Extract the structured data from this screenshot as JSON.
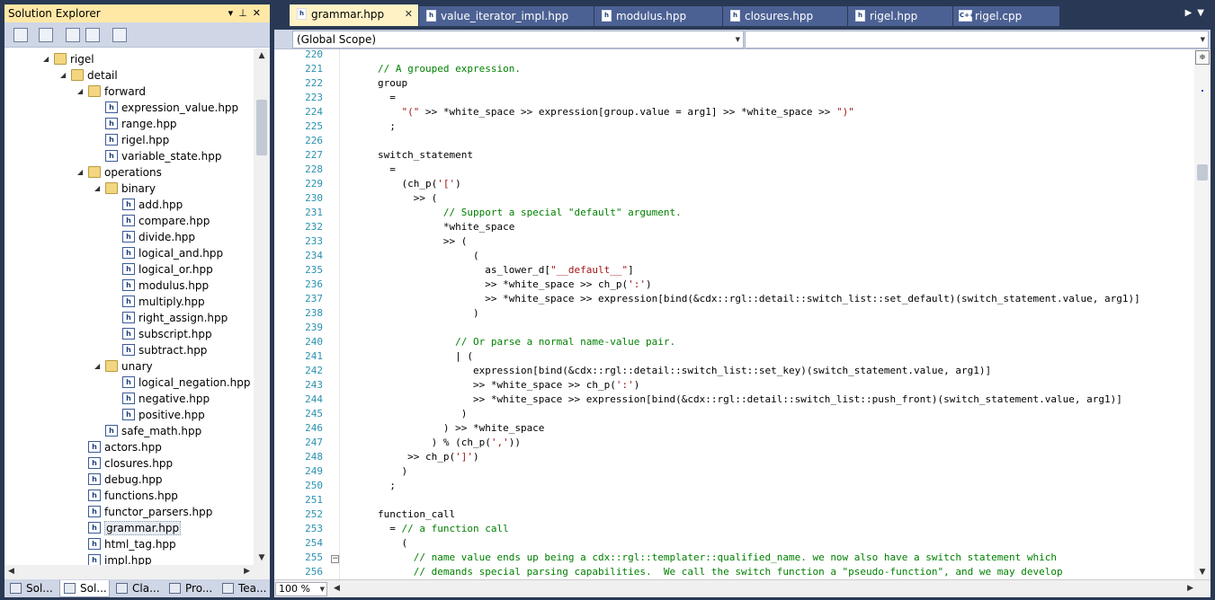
{
  "solution_explorer": {
    "title": "Solution Explorer",
    "title_buttons": [
      "▾",
      "⊥",
      "✕"
    ],
    "tree": [
      {
        "label": "rigel",
        "kind": "folder",
        "depth": 2,
        "expanded": true
      },
      {
        "label": "detail",
        "kind": "folder",
        "depth": 3,
        "expanded": true
      },
      {
        "label": "forward",
        "kind": "folder",
        "depth": 4,
        "expanded": true
      },
      {
        "label": "expression_value.hpp",
        "kind": "file",
        "depth": 5
      },
      {
        "label": "range.hpp",
        "kind": "file",
        "depth": 5
      },
      {
        "label": "rigel.hpp",
        "kind": "file",
        "depth": 5
      },
      {
        "label": "variable_state.hpp",
        "kind": "file",
        "depth": 5
      },
      {
        "label": "operations",
        "kind": "folder",
        "depth": 4,
        "expanded": true
      },
      {
        "label": "binary",
        "kind": "folder",
        "depth": 5,
        "expanded": true
      },
      {
        "label": "add.hpp",
        "kind": "file",
        "depth": 6
      },
      {
        "label": "compare.hpp",
        "kind": "file",
        "depth": 6
      },
      {
        "label": "divide.hpp",
        "kind": "file",
        "depth": 6
      },
      {
        "label": "logical_and.hpp",
        "kind": "file",
        "depth": 6
      },
      {
        "label": "logical_or.hpp",
        "kind": "file",
        "depth": 6
      },
      {
        "label": "modulus.hpp",
        "kind": "file",
        "depth": 6
      },
      {
        "label": "multiply.hpp",
        "kind": "file",
        "depth": 6
      },
      {
        "label": "right_assign.hpp",
        "kind": "file",
        "depth": 6
      },
      {
        "label": "subscript.hpp",
        "kind": "file",
        "depth": 6
      },
      {
        "label": "subtract.hpp",
        "kind": "file",
        "depth": 6
      },
      {
        "label": "unary",
        "kind": "folder",
        "depth": 5,
        "expanded": true
      },
      {
        "label": "logical_negation.hpp",
        "kind": "file",
        "depth": 6
      },
      {
        "label": "negative.hpp",
        "kind": "file",
        "depth": 6
      },
      {
        "label": "positive.hpp",
        "kind": "file",
        "depth": 6
      },
      {
        "label": "safe_math.hpp",
        "kind": "file",
        "depth": 5
      },
      {
        "label": "actors.hpp",
        "kind": "file",
        "depth": 4
      },
      {
        "label": "closures.hpp",
        "kind": "file",
        "depth": 4
      },
      {
        "label": "debug.hpp",
        "kind": "file",
        "depth": 4
      },
      {
        "label": "functions.hpp",
        "kind": "file",
        "depth": 4
      },
      {
        "label": "functor_parsers.hpp",
        "kind": "file",
        "depth": 4
      },
      {
        "label": "grammar.hpp",
        "kind": "file",
        "depth": 4,
        "selected": true
      },
      {
        "label": "html_tag.hpp",
        "kind": "file",
        "depth": 4
      },
      {
        "label": "impl.hpp",
        "kind": "file",
        "depth": 4
      }
    ],
    "bottom_tabs": [
      {
        "label": "Sol...",
        "active": false
      },
      {
        "label": "Sol...",
        "active": true
      },
      {
        "label": "Cla...",
        "active": false
      },
      {
        "label": "Pro...",
        "active": false
      },
      {
        "label": "Tea...",
        "active": false
      }
    ]
  },
  "editor": {
    "tabs": [
      {
        "label": "grammar.hpp",
        "active": true,
        "icon": "h"
      },
      {
        "label": "value_iterator_impl.hpp",
        "active": false,
        "icon": "h"
      },
      {
        "label": "modulus.hpp",
        "active": false,
        "icon": "h"
      },
      {
        "label": "closures.hpp",
        "active": false,
        "icon": "h"
      },
      {
        "label": "rigel.hpp",
        "active": false,
        "icon": "h"
      },
      {
        "label": "rigel.cpp",
        "active": false,
        "icon": "C++"
      }
    ],
    "scope": "(Global Scope)",
    "member": "",
    "zoom": "100 %",
    "lines": [
      {
        "n": "220",
        "t": ""
      },
      {
        "n": "221",
        "t": "// A grouped expression.",
        "c": true
      },
      {
        "n": "222",
        "t": "group"
      },
      {
        "n": "223",
        "t": "  ="
      },
      {
        "n": "224",
        "t": "    \"(\" >> *white_space >> expression[group.value = arg1] >> *white_space >> \")\""
      },
      {
        "n": "225",
        "t": "  ;"
      },
      {
        "n": "226",
        "t": ""
      },
      {
        "n": "227",
        "t": "switch_statement"
      },
      {
        "n": "228",
        "t": "  ="
      },
      {
        "n": "229",
        "t": "    (ch_p('[')"
      },
      {
        "n": "230",
        "t": "      >> ("
      },
      {
        "n": "231",
        "t": "           // Support a special \"default\" argument.",
        "c": true
      },
      {
        "n": "232",
        "t": "           *white_space"
      },
      {
        "n": "233",
        "t": "           >> ("
      },
      {
        "n": "234",
        "t": "                ("
      },
      {
        "n": "235",
        "t": "                  as_lower_d[\"__default__\"]"
      },
      {
        "n": "236",
        "t": "                  >> *white_space >> ch_p(':')"
      },
      {
        "n": "237",
        "t": "                  >> *white_space >> expression[bind(&cdx::rgl::detail::switch_list::set_default)(switch_statement.value, arg1)]"
      },
      {
        "n": "238",
        "t": "                )"
      },
      {
        "n": "239",
        "t": ""
      },
      {
        "n": "240",
        "t": "             // Or parse a normal name-value pair.",
        "c": true
      },
      {
        "n": "241",
        "t": "             | ("
      },
      {
        "n": "242",
        "t": "                expression[bind(&cdx::rgl::detail::switch_list::set_key)(switch_statement.value, arg1)]"
      },
      {
        "n": "243",
        "t": "                >> *white_space >> ch_p(':')"
      },
      {
        "n": "244",
        "t": "                >> *white_space >> expression[bind(&cdx::rgl::detail::switch_list::push_front)(switch_statement.value, arg1)]"
      },
      {
        "n": "245",
        "t": "              )"
      },
      {
        "n": "246",
        "t": "           ) >> *white_space"
      },
      {
        "n": "247",
        "t": "         ) % (ch_p(','))"
      },
      {
        "n": "248",
        "t": "     >> ch_p(']')"
      },
      {
        "n": "249",
        "t": "    )"
      },
      {
        "n": "250",
        "t": "  ;"
      },
      {
        "n": "251",
        "t": ""
      },
      {
        "n": "252",
        "t": "function_call"
      },
      {
        "n": "253",
        "t": "  = // a function call"
      },
      {
        "n": "254",
        "t": "    ("
      },
      {
        "n": "255",
        "t": "      // name value ends up being a cdx::rgl::templater::qualified_name. we now also have a switch statement which",
        "c": true
      },
      {
        "n": "256",
        "t": "      // demands special parsing capabilities.  We call the switch function a \"pseudo-function\", and we may develop",
        "c": true
      }
    ]
  }
}
